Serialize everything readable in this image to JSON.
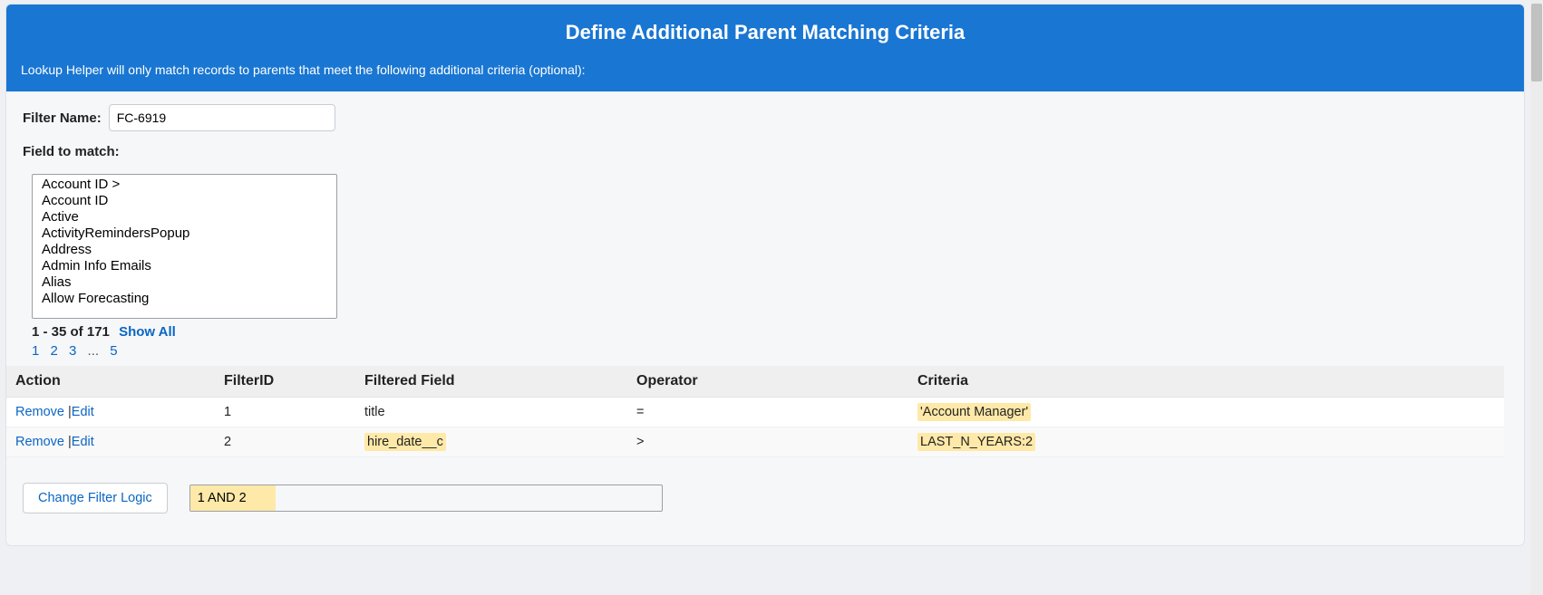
{
  "header": {
    "title": "Define Additional Parent Matching Criteria",
    "subtitle": "Lookup Helper will only match records to parents that meet the following additional criteria (optional):"
  },
  "filterName": {
    "label": "Filter Name:",
    "value": "FC-6919"
  },
  "fieldToMatch": {
    "label": "Field to match:",
    "options": [
      "Account ID >",
      "Account ID",
      "Active",
      "ActivityRemindersPopup",
      "Address",
      "Admin Info Emails",
      "Alias",
      "Allow Forecasting"
    ],
    "pagerCount": "1 - 35 of 171",
    "showAll": "Show All",
    "pages": [
      "1",
      "2",
      "3"
    ],
    "ellipsis": "...",
    "lastPage": "5"
  },
  "table": {
    "headers": {
      "action": "Action",
      "filterId": "FilterID",
      "field": "Filtered Field",
      "operator": "Operator",
      "criteria": "Criteria"
    },
    "rows": [
      {
        "remove": "Remove",
        "edit": "Edit",
        "filterId": "1",
        "field": "title",
        "fieldHighlighted": false,
        "operator": "=",
        "criteria": "'Account Manager'",
        "criteriaHighlighted": true
      },
      {
        "remove": "Remove",
        "edit": "Edit",
        "filterId": "2",
        "field": "hire_date__c",
        "fieldHighlighted": true,
        "operator": ">",
        "criteria": "LAST_N_YEARS:2",
        "criteriaHighlighted": true
      }
    ]
  },
  "logic": {
    "buttonLabel": "Change Filter Logic",
    "value": "1 AND 2"
  }
}
